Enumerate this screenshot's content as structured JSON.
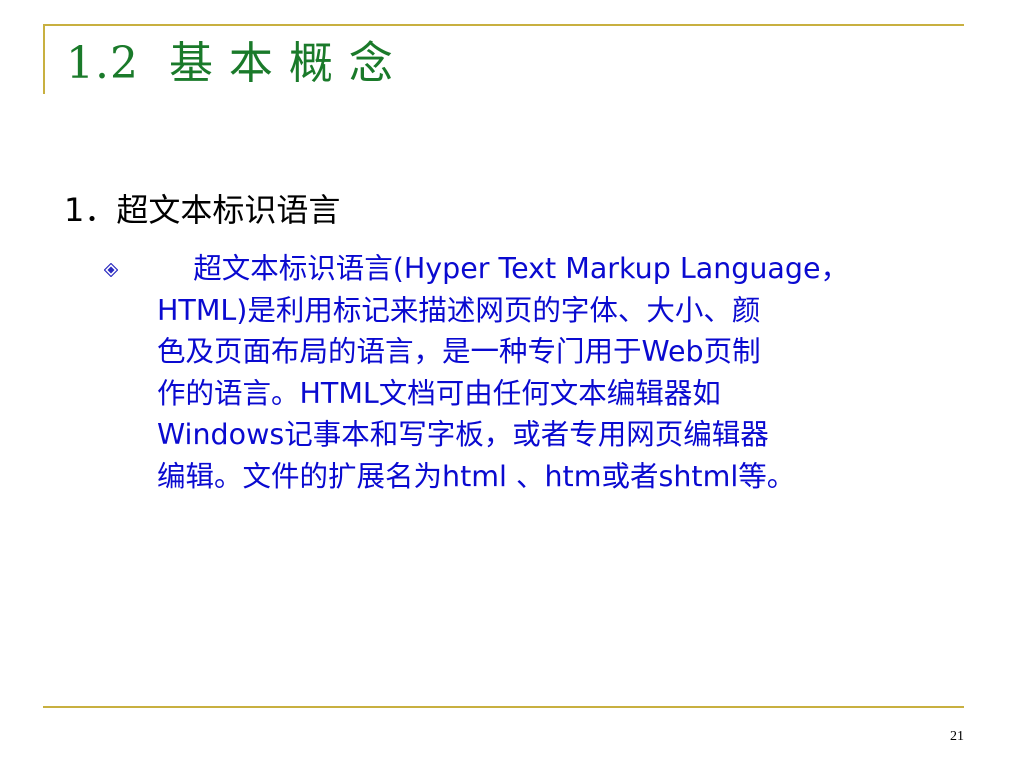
{
  "slide": {
    "title": "1.2  基 本 概 念",
    "heading": "1．超文本标识语言",
    "bullet_icon": "diamond-bullet-icon",
    "body_lines": [
      "    超文本标识语言(Hyper Text Markup Language，",
      "HTML)是利用标记来描述网页的字体、大小、颜",
      "色及页面布局的语言，是一种专门用于Web页制",
      "作的语言。HTML文档可由任何文本编辑器如",
      "Windows记事本和写字板，或者专用网页编辑器",
      "编辑。文件的扩展名为html 、htm或者shtml等。"
    ],
    "page_number": "21",
    "colors": {
      "title": "#1a7a2a",
      "body": "#0a0ad0",
      "frame": "#c8b040",
      "bullet": "#2a2ac0"
    }
  }
}
